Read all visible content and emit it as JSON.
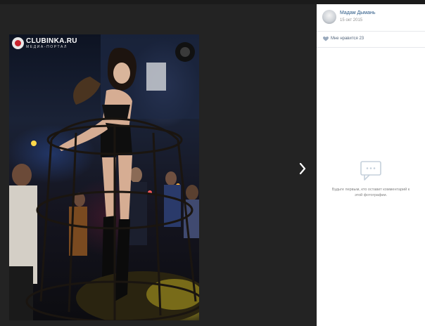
{
  "photo": {
    "watermark_title": "CLUBINKA.RU",
    "watermark_subtitle": "МЕДИА-ПОРТАЛ",
    "logo_icon": "clubinka-logo",
    "next_icon": "chevron-right-icon"
  },
  "sidebar": {
    "author_name": "Мадам Дымань",
    "post_date": "15 окт 2015",
    "likes_label": "Мне нравится",
    "likes_count": "23",
    "empty_comments_text": "Будьте первым, кто оставит комментарий к этой фотографии."
  },
  "colors": {
    "viewer_bg": "#232323",
    "sidebar_bg": "#ffffff",
    "link": "#2a5885",
    "muted": "#939393",
    "divider": "#e7e8ec"
  }
}
